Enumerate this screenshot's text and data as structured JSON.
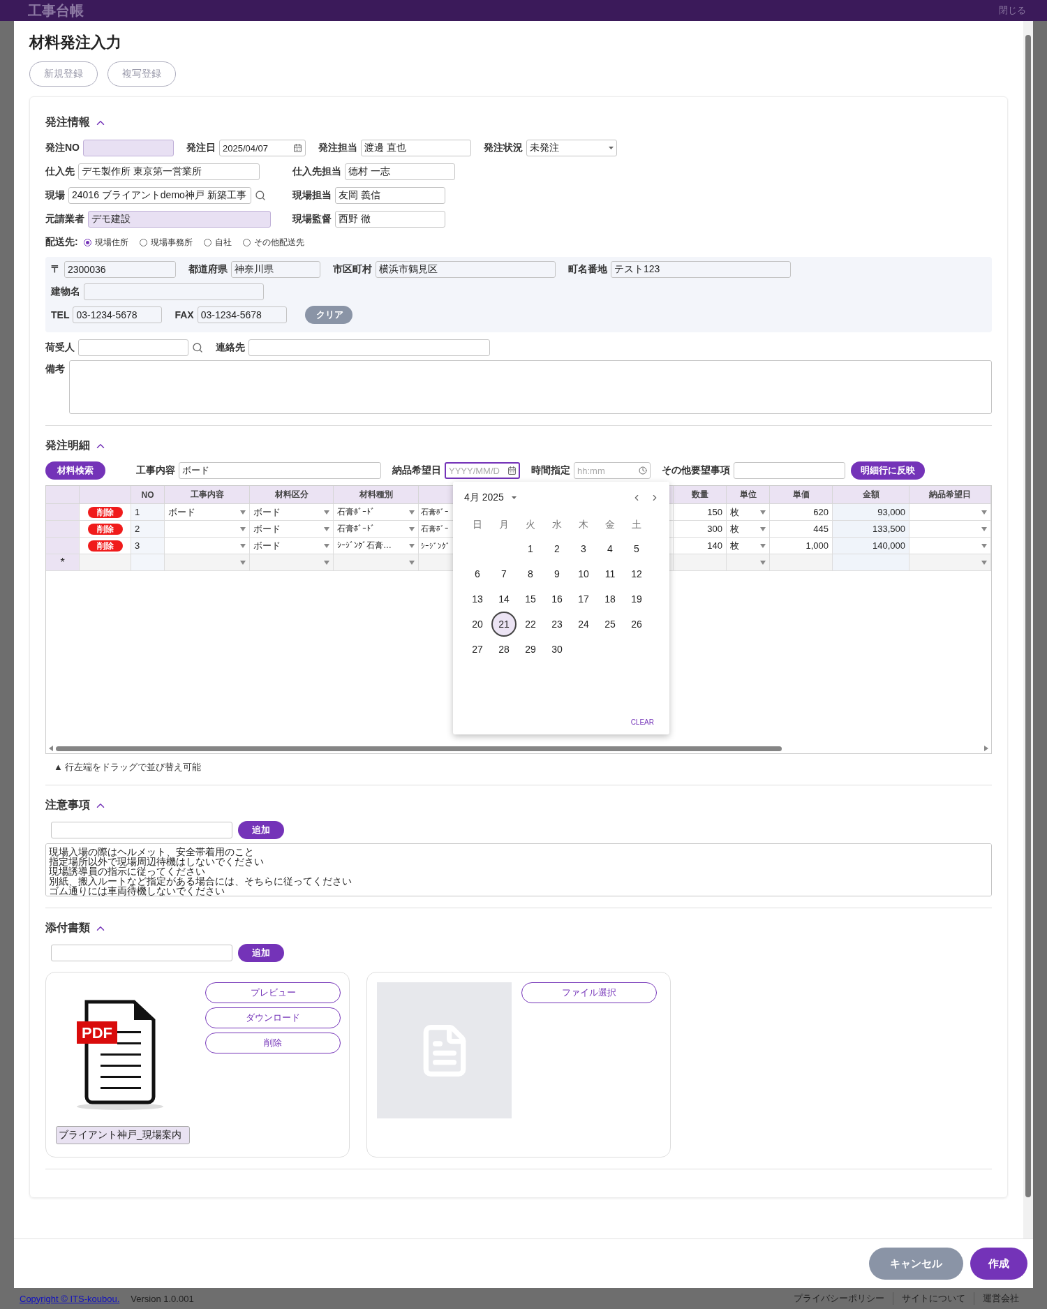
{
  "app_header": {
    "title": "工事台帳",
    "close_label": "閉じる"
  },
  "dialog": {
    "title": "材料発注入力",
    "top_buttons": [
      {
        "label": "新規登録",
        "disabled": true
      },
      {
        "label": "複写登録",
        "disabled": true
      }
    ]
  },
  "order_info": {
    "title": "発注情報",
    "expanded": true,
    "rows": [
      [
        {
          "label": "発注NO",
          "kind": "tinted"
        },
        {
          "label": "発注日",
          "value": "2025/04/07",
          "kind": "date"
        },
        {
          "label": "発注担当",
          "value": "渡邊 直也",
          "kind": "text"
        },
        {
          "label": "発注状況",
          "value": "未発注",
          "kind": "select"
        }
      ],
      [
        {
          "label": "仕入先",
          "value": "デモ製作所 東京第一営業所",
          "kind": "text"
        },
        {
          "label": "仕入先担当",
          "value": "德村 一志",
          "kind": "text"
        }
      ],
      [
        {
          "label": "現場",
          "value": "24016 ブライアントdemo神戸 新築工事",
          "kind": "search"
        },
        {
          "label": "現場担当",
          "value": "友岡 義信",
          "kind": "text"
        }
      ],
      [
        {
          "label": "元請業者",
          "value": "デモ建設",
          "kind": "tinted"
        },
        {
          "label": "現場監督",
          "value": "西野 徹",
          "kind": "text"
        }
      ]
    ],
    "delivery": {
      "label": "配送先:",
      "options": [
        {
          "label": "現場住所",
          "selected": true
        },
        {
          "label": "現場事務所",
          "selected": false
        },
        {
          "label": "自社",
          "selected": false
        },
        {
          "label": "その他配送先",
          "selected": false
        }
      ]
    },
    "address": {
      "rows": [
        [
          {
            "label": "〒",
            "value": "2300036"
          },
          {
            "label": "都道府県",
            "value": "神奈川県"
          },
          {
            "label": "市区町村",
            "value": "横浜市鶴見区"
          },
          {
            "label": "町名番地",
            "value": "テスト123"
          }
        ],
        [
          {
            "label": "建物名"
          }
        ],
        [
          {
            "label": "TEL",
            "value": "03-1234-5678"
          },
          {
            "label": "FAX",
            "value": "03-1234-5678"
          }
        ]
      ],
      "clear_button": "クリア"
    },
    "consignee": {
      "label": "荷受人"
    },
    "contact": {
      "label": "連絡先"
    },
    "remarks": {
      "label": "備考"
    }
  },
  "order_details": {
    "title": "発注明細",
    "expanded": true,
    "search_button": "材料検索",
    "filters": [
      {
        "label": "工事内容",
        "value": "ボード",
        "kind": "text",
        "focused": false
      },
      {
        "label": "納品希望日",
        "placeholder": "YYYY/MM/D",
        "kind": "date",
        "focused": true
      },
      {
        "label": "時間指定",
        "placeholder": "hh:mm",
        "kind": "time",
        "focused": false
      },
      {
        "label": "その他要望事項",
        "kind": "text",
        "focused": false
      }
    ],
    "apply_button": "明細行に反映",
    "table": {
      "columns": [
        "NO",
        "工事内容",
        "材料区分",
        "材料種別",
        "数量",
        "単位",
        "単価",
        "金額",
        "納品希望日"
      ],
      "rows": [
        {
          "delete": "削除",
          "no": "1",
          "work": "ボード",
          "category": "ボード",
          "type": "石膏ﾎﾞｰﾄﾞ",
          "column_6": "石膏ﾎﾞｰ",
          "quantity": "150",
          "unit": "枚",
          "unit_price": "620",
          "amount": "93,000"
        },
        {
          "delete": "削除",
          "no": "2",
          "category": "ボード",
          "type": "石膏ﾎﾞｰﾄﾞ",
          "column_6": "石膏ﾎﾞｰ",
          "quantity": "300",
          "unit": "枚",
          "unit_price": "445",
          "amount": "133,500"
        },
        {
          "delete": "削除",
          "no": "3",
          "category": "ボード",
          "type": "ｼｰｼﾞﾝｸﾞ石膏…",
          "column_6": "ｼｰｼﾞﾝｸﾞ",
          "quantity": "140",
          "unit": "枚",
          "unit_price": "1,000",
          "amount": "140,000"
        }
      ],
      "new_row_marker": "*"
    },
    "hint": "▲ 行左端をドラッグで並び替え可能",
    "calendar": {
      "month_label": "4月 2025",
      "weekdays": [
        "日",
        "月",
        "火",
        "水",
        "木",
        "金",
        "土"
      ],
      "weeks": [
        [
          {
            "label": "1",
            "selected": false
          },
          {
            "label": "2",
            "selected": false
          },
          {
            "label": "3",
            "selected": false
          },
          {
            "label": "4",
            "selected": false
          },
          {
            "label": "5",
            "selected": false
          }
        ],
        [
          {
            "label": "6",
            "selected": false
          },
          {
            "label": "7",
            "selected": false
          },
          {
            "label": "8",
            "selected": false
          },
          {
            "label": "9",
            "selected": false
          },
          {
            "label": "10",
            "selected": false
          },
          {
            "label": "11",
            "selected": false
          },
          {
            "label": "12",
            "selected": false
          }
        ],
        [
          {
            "label": "13",
            "selected": false
          },
          {
            "label": "14",
            "selected": false
          },
          {
            "label": "15",
            "selected": false
          },
          {
            "label": "16",
            "selected": false
          },
          {
            "label": "17",
            "selected": false
          },
          {
            "label": "18",
            "selected": false
          },
          {
            "label": "19",
            "selected": false
          }
        ],
        [
          {
            "label": "20",
            "selected": false
          },
          {
            "label": "21",
            "selected": true
          },
          {
            "label": "22",
            "selected": false
          },
          {
            "label": "23",
            "selected": false
          },
          {
            "label": "24",
            "selected": false
          },
          {
            "label": "25",
            "selected": false
          },
          {
            "label": "26",
            "selected": false
          }
        ],
        [
          {
            "label": "27",
            "selected": false
          },
          {
            "label": "28",
            "selected": false
          },
          {
            "label": "29",
            "selected": false
          },
          {
            "label": "30",
            "selected": false
          }
        ]
      ],
      "clear_button": "CLEAR"
    }
  },
  "notes": {
    "title": "注意事項",
    "expanded": true,
    "add_button": "追加",
    "lines": [
      "現場入場の際はヘルメット、安全帯着用のこと",
      "指定場所以外で現場周辺待機はしないでください",
      "現場誘導員の指示に従ってください",
      "別紙、搬入ルートなど指定がある場合には、そちらに従ってください",
      "ゴム通りには車両待機しないでください"
    ]
  },
  "attachments": {
    "title": "添付書類",
    "expanded": true,
    "add_button": "追加",
    "files": [
      {
        "kind": "file",
        "thumbnail_label": "PDF",
        "name": "ブライアント神戸_現場案内",
        "actions": [
          "プレビュー",
          "ダウンロード",
          "削除"
        ]
      },
      {
        "kind": "empty",
        "actions": [
          "ファイル選択"
        ]
      }
    ]
  },
  "dialog_actions": [
    {
      "label": "キャンセル",
      "kind": "secondary"
    },
    {
      "label": "作成",
      "kind": "primary"
    }
  ],
  "page_footer": {
    "copyright": "Copyright © ITS-koubou.",
    "version": "Version 1.0.001",
    "links": [
      "プライバシーポリシー",
      "サイトについて",
      "運営会社"
    ]
  }
}
